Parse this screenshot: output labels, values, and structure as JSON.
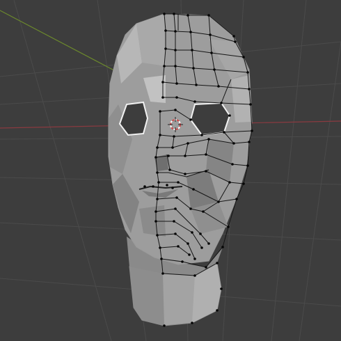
{
  "app": {
    "view": "3d-viewport",
    "mode": "edit-mode",
    "object": "head-mesh"
  },
  "viewport": {
    "background_color": "#3d3d3d",
    "grid_color": "#4b4b4b",
    "x_axis_color": "#8a3a40",
    "y_axis_color": "#6c8a2c",
    "mesh_face_color": "#9a9a9a",
    "mesh_edge_color": "#101010",
    "cursor_icon": "3d-cursor-icon"
  }
}
